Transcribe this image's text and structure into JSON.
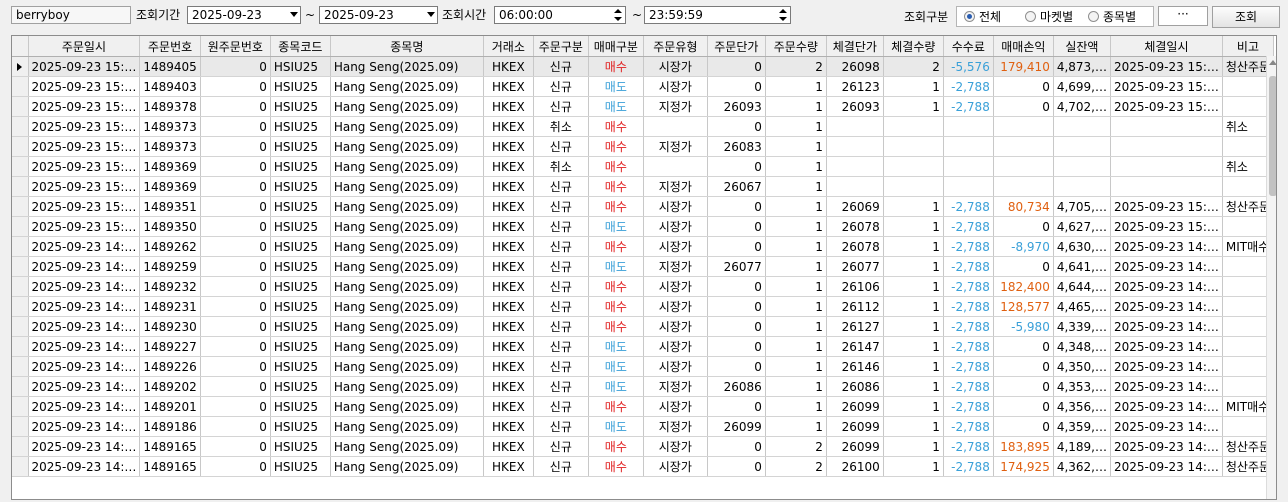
{
  "toolbar": {
    "account": "berryboy",
    "period_label": "조회기간",
    "date_from": "2025-09-23",
    "tilde": "~",
    "date_to": "2025-09-23",
    "time_label": "조회시간",
    "time_from": "06:00:00",
    "time_to": "23:59:59",
    "type_label": "조회구분",
    "radio_all": "전체",
    "radio_market": "마켓별",
    "radio_item": "종목별",
    "more": "···",
    "search_button": "조회"
  },
  "columns": [
    "주문일시",
    "주문번호",
    "원주문번호",
    "종목코드",
    "종목명",
    "거래소",
    "주문구분",
    "매매구분",
    "주문유형",
    "주문단가",
    "주문수량",
    "체결단가",
    "체결수량",
    "수수료",
    "매매손익",
    "실잔액",
    "체결일시",
    "비고"
  ],
  "rows": [
    [
      "2025-09-23 15:…",
      "1489405",
      "0",
      "HSIU25",
      "Hang Seng(2025.09)",
      "HKEX",
      "신규",
      "매수",
      "시장가",
      "0",
      "2",
      "26098",
      "2",
      "-5,576",
      "179,410",
      "4,873,…",
      "2025-09-23 15:…",
      "청산주문"
    ],
    [
      "2025-09-23 15:…",
      "1489403",
      "0",
      "HSIU25",
      "Hang Seng(2025.09)",
      "HKEX",
      "신규",
      "매도",
      "시장가",
      "0",
      "1",
      "26123",
      "1",
      "-2,788",
      "0",
      "4,699,…",
      "2025-09-23 15:…",
      ""
    ],
    [
      "2025-09-23 15:…",
      "1489378",
      "0",
      "HSIU25",
      "Hang Seng(2025.09)",
      "HKEX",
      "신규",
      "매도",
      "지정가",
      "26093",
      "1",
      "26093",
      "1",
      "-2,788",
      "0",
      "4,702,…",
      "2025-09-23 15:…",
      ""
    ],
    [
      "2025-09-23 15:…",
      "1489373",
      "0",
      "HSIU25",
      "Hang Seng(2025.09)",
      "HKEX",
      "취소",
      "매수",
      "",
      "0",
      "1",
      "",
      "",
      "",
      "",
      "",
      "",
      "취소"
    ],
    [
      "2025-09-23 15:…",
      "1489373",
      "0",
      "HSIU25",
      "Hang Seng(2025.09)",
      "HKEX",
      "신규",
      "매수",
      "지정가",
      "26083",
      "1",
      "",
      "",
      "",
      "",
      "",
      "",
      ""
    ],
    [
      "2025-09-23 15:…",
      "1489369",
      "0",
      "HSIU25",
      "Hang Seng(2025.09)",
      "HKEX",
      "취소",
      "매수",
      "",
      "0",
      "1",
      "",
      "",
      "",
      "",
      "",
      "",
      "취소"
    ],
    [
      "2025-09-23 15:…",
      "1489369",
      "0",
      "HSIU25",
      "Hang Seng(2025.09)",
      "HKEX",
      "신규",
      "매수",
      "지정가",
      "26067",
      "1",
      "",
      "",
      "",
      "",
      "",
      "",
      ""
    ],
    [
      "2025-09-23 15:…",
      "1489351",
      "0",
      "HSIU25",
      "Hang Seng(2025.09)",
      "HKEX",
      "신규",
      "매수",
      "시장가",
      "0",
      "1",
      "26069",
      "1",
      "-2,788",
      "80,734",
      "4,705,…",
      "2025-09-23 15:…",
      "청산주문"
    ],
    [
      "2025-09-23 15:…",
      "1489350",
      "0",
      "HSIU25",
      "Hang Seng(2025.09)",
      "HKEX",
      "신규",
      "매도",
      "시장가",
      "0",
      "1",
      "26078",
      "1",
      "-2,788",
      "0",
      "4,627,…",
      "2025-09-23 15:…",
      ""
    ],
    [
      "2025-09-23 14:…",
      "1489262",
      "0",
      "HSIU25",
      "Hang Seng(2025.09)",
      "HKEX",
      "신규",
      "매수",
      "시장가",
      "0",
      "1",
      "26078",
      "1",
      "-2,788",
      "-8,970",
      "4,630,…",
      "2025-09-23 14:…",
      "MIT매수"
    ],
    [
      "2025-09-23 14:…",
      "1489259",
      "0",
      "HSIU25",
      "Hang Seng(2025.09)",
      "HKEX",
      "신규",
      "매도",
      "지정가",
      "26077",
      "1",
      "26077",
      "1",
      "-2,788",
      "0",
      "4,641,…",
      "2025-09-23 14:…",
      ""
    ],
    [
      "2025-09-23 14:…",
      "1489232",
      "0",
      "HSIU25",
      "Hang Seng(2025.09)",
      "HKEX",
      "신규",
      "매수",
      "시장가",
      "0",
      "1",
      "26106",
      "1",
      "-2,788",
      "182,400",
      "4,644,…",
      "2025-09-23 14:…",
      ""
    ],
    [
      "2025-09-23 14:…",
      "1489231",
      "0",
      "HSIU25",
      "Hang Seng(2025.09)",
      "HKEX",
      "신규",
      "매수",
      "시장가",
      "0",
      "1",
      "26112",
      "1",
      "-2,788",
      "128,577",
      "4,465,…",
      "2025-09-23 14:…",
      ""
    ],
    [
      "2025-09-23 14:…",
      "1489230",
      "0",
      "HSIU25",
      "Hang Seng(2025.09)",
      "HKEX",
      "신규",
      "매수",
      "시장가",
      "0",
      "1",
      "26127",
      "1",
      "-2,788",
      "-5,980",
      "4,339,…",
      "2025-09-23 14:…",
      ""
    ],
    [
      "2025-09-23 14:…",
      "1489227",
      "0",
      "HSIU25",
      "Hang Seng(2025.09)",
      "HKEX",
      "신규",
      "매도",
      "시장가",
      "0",
      "1",
      "26147",
      "1",
      "-2,788",
      "0",
      "4,348,…",
      "2025-09-23 14:…",
      ""
    ],
    [
      "2025-09-23 14:…",
      "1489226",
      "0",
      "HSIU25",
      "Hang Seng(2025.09)",
      "HKEX",
      "신규",
      "매도",
      "시장가",
      "0",
      "1",
      "26146",
      "1",
      "-2,788",
      "0",
      "4,350,…",
      "2025-09-23 14:…",
      ""
    ],
    [
      "2025-09-23 14:…",
      "1489202",
      "0",
      "HSIU25",
      "Hang Seng(2025.09)",
      "HKEX",
      "신규",
      "매도",
      "지정가",
      "26086",
      "1",
      "26086",
      "1",
      "-2,788",
      "0",
      "4,353,…",
      "2025-09-23 14:…",
      ""
    ],
    [
      "2025-09-23 14:…",
      "1489201",
      "0",
      "HSIU25",
      "Hang Seng(2025.09)",
      "HKEX",
      "신규",
      "매수",
      "시장가",
      "0",
      "1",
      "26099",
      "1",
      "-2,788",
      "0",
      "4,356,…",
      "2025-09-23 14:…",
      "MIT매수"
    ],
    [
      "2025-09-23 14:…",
      "1489186",
      "0",
      "HSIU25",
      "Hang Seng(2025.09)",
      "HKEX",
      "신규",
      "매도",
      "지정가",
      "26099",
      "1",
      "26099",
      "1",
      "-2,788",
      "0",
      "4,359,…",
      "2025-09-23 14:…",
      ""
    ],
    [
      "2025-09-23 14:…",
      "1489165",
      "0",
      "HSIU25",
      "Hang Seng(2025.09)",
      "HKEX",
      "신규",
      "매수",
      "시장가",
      "0",
      "2",
      "26099",
      "1",
      "-2,788",
      "183,895",
      "4,189,…",
      "2025-09-23 14:…",
      "청산주문"
    ],
    [
      "2025-09-23 14:…",
      "1489165",
      "0",
      "HSIU25",
      "Hang Seng(2025.09)",
      "HKEX",
      "신규",
      "매수",
      "시장가",
      "0",
      "2",
      "26100",
      "1",
      "-2,788",
      "174,925",
      "4,362,…",
      "2025-09-23 14:…",
      "청산주문"
    ]
  ],
  "selected_row": 0,
  "colors": {
    "buy": "#e02020",
    "sell": "#3aa0d8",
    "fee": "#3aa0d8",
    "profit": "#e06010",
    "loss": "#3aa0d8"
  }
}
